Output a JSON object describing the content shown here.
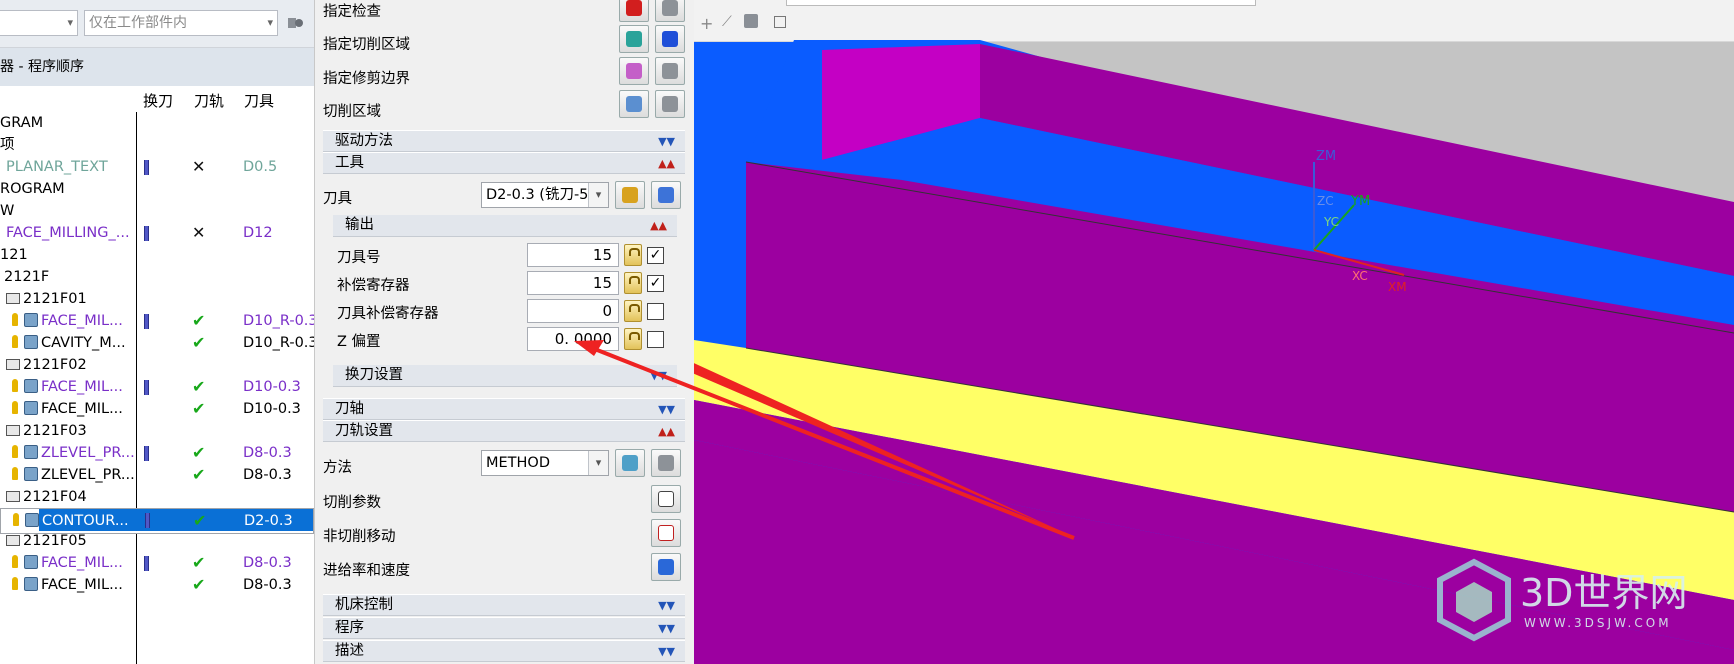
{
  "navigator": {
    "combo1": "",
    "combo2": "仅在工作部件内",
    "title": "器 - 程序顺序",
    "columns": [
      "换刀",
      "刀轨",
      "刀具"
    ],
    "rows": [
      {
        "name": "GRAM",
        "indent": 0,
        "style": "",
        "c1": false,
        "c2": "",
        "c3": ""
      },
      {
        "name": "项",
        "indent": 0,
        "style": "",
        "c1": false,
        "c2": "",
        "c3": ""
      },
      {
        "name": "PLANAR_TEXT",
        "indent": 6,
        "style": "green",
        "c1": true,
        "c2": "✕",
        "c3": "D0.5",
        "c3style": "green"
      },
      {
        "name": "ROGRAM",
        "indent": 0,
        "style": "",
        "c1": false,
        "c2": "",
        "c3": ""
      },
      {
        "name": "W",
        "indent": 0,
        "style": "",
        "c1": false,
        "c2": "",
        "c3": ""
      },
      {
        "name": "FACE_MILLING_...",
        "indent": 6,
        "style": "purple",
        "c1": true,
        "c2": "✕",
        "c3": "D12",
        "c3style": "purple"
      },
      {
        "name": "121",
        "indent": 0,
        "style": "",
        "c1": false,
        "c2": "",
        "c3": ""
      },
      {
        "name": "2121F",
        "indent": 4,
        "style": "",
        "c1": false,
        "c2": "",
        "c3": ""
      },
      {
        "name": "2121F01",
        "indent": 6,
        "style": "",
        "folder": true,
        "c1": false,
        "c2": "",
        "c3": ""
      },
      {
        "name": "FACE_MIL...",
        "indent": 12,
        "style": "purple",
        "op": true,
        "c1": true,
        "c2": "✔",
        "c3": "D10_R-0.3",
        "c3style": "purple"
      },
      {
        "name": "CAVITY_M...",
        "indent": 12,
        "style": "",
        "op": true,
        "c1": false,
        "c2": "✔",
        "c3": "D10_R-0.3",
        "c3style": ""
      },
      {
        "name": "2121F02",
        "indent": 6,
        "style": "",
        "folder": true,
        "c1": false,
        "c2": "",
        "c3": ""
      },
      {
        "name": "FACE_MIL...",
        "indent": 12,
        "style": "purple",
        "op": true,
        "c1": true,
        "c2": "✔",
        "c3": "D10-0.3",
        "c3style": "purple"
      },
      {
        "name": "FACE_MIL...",
        "indent": 12,
        "style": "",
        "op": true,
        "c1": false,
        "c2": "✔",
        "c3": "D10-0.3",
        "c3style": ""
      },
      {
        "name": "2121F03",
        "indent": 6,
        "style": "",
        "folder": true,
        "c1": false,
        "c2": "",
        "c3": ""
      },
      {
        "name": "ZLEVEL_PR...",
        "indent": 12,
        "style": "purple",
        "op": true,
        "c1": true,
        "c2": "✔",
        "c3": "D8-0.3",
        "c3style": "purple"
      },
      {
        "name": "ZLEVEL_PR...",
        "indent": 12,
        "style": "",
        "op": true,
        "c1": false,
        "c2": "✔",
        "c3": "D8-0.3",
        "c3style": ""
      },
      {
        "name": "2121F04",
        "indent": 6,
        "style": "",
        "folder": true,
        "c1": false,
        "c2": "",
        "c3": ""
      },
      {
        "name": "CONTOUR...",
        "indent": 12,
        "style": "selected",
        "op": true,
        "c1": true,
        "c2": "✔",
        "c3": "D2-0.3",
        "c3style": "selected",
        "selected": true
      },
      {
        "name": "2121F05",
        "indent": 6,
        "style": "",
        "folder": true,
        "c1": false,
        "c2": "",
        "c3": ""
      },
      {
        "name": "FACE_MIL...",
        "indent": 12,
        "style": "purple",
        "op": true,
        "c1": true,
        "c2": "✔",
        "c3": "D8-0.3",
        "c3style": "purple"
      },
      {
        "name": "FACE_MIL...",
        "indent": 12,
        "style": "",
        "op": true,
        "c1": false,
        "c2": "✔",
        "c3": "D8-0.3",
        "c3style": ""
      }
    ]
  },
  "dialog": {
    "geometry_rows": [
      "指定检查",
      "指定切削区域",
      "指定修剪边界",
      "切削区域"
    ],
    "sections": {
      "drive": "驱动方法",
      "tool": "工具",
      "output": "输出",
      "toolchange": "换刀设置",
      "axis": "刀轴",
      "path": "刀轨设置",
      "machine": "机床控制",
      "program": "程序",
      "desc": "描述"
    },
    "tool_label": "刀具",
    "tool_value": "D2-0.3 (铣刀-5",
    "output_fields": [
      {
        "label": "刀具号",
        "value": "15",
        "checked": true
      },
      {
        "label": "补偿寄存器",
        "value": "15",
        "checked": true
      },
      {
        "label": "刀具补偿寄存器",
        "value": "0",
        "checked": false
      },
      {
        "label": "Z 偏置",
        "value": "0. 0000",
        "checked": false
      }
    ],
    "method_label": "方法",
    "method_value": "METHOD",
    "path_rows": [
      "切削参数",
      "非切削移动",
      "进给率和速度"
    ]
  },
  "viewport": {
    "axes": {
      "zm": "ZM",
      "zc": "ZC",
      "ym": "YM",
      "yc": "YC",
      "xc": "XC",
      "xm": "XM"
    },
    "colors": {
      "blue": "#0a5cff",
      "purple": "#9c00a0",
      "magenta": "#c800c8",
      "yellow": "#ffff66",
      "arrow": "#ee2222"
    },
    "watermark_title": "3D世界网",
    "watermark_url": "WWW.3DSJW.COM"
  }
}
